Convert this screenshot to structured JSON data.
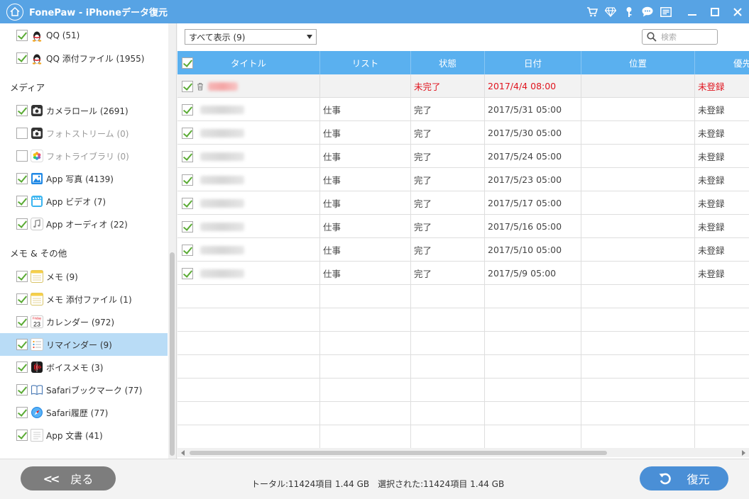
{
  "app": {
    "title": "FonePaw - iPhoneデータ復元"
  },
  "colors": {
    "titlebar": "#57a3e4",
    "header": "#5ab0ef",
    "selected": "#b9dcf6",
    "red": "#e0141e",
    "check": "#5bab35"
  },
  "title_icons": [
    "cart-icon",
    "diamond-icon",
    "key-icon",
    "chat-icon",
    "menu-icon",
    "minimize-icon",
    "maximize-icon",
    "close-icon"
  ],
  "sidebar": {
    "items": [
      {
        "type": "item",
        "label": "QQ (51)",
        "icon": "qq-icon",
        "checked": true
      },
      {
        "type": "item",
        "label": "QQ 添付ファイル (1955)",
        "icon": "qq-icon",
        "checked": true
      },
      {
        "type": "category",
        "label": "メディア"
      },
      {
        "type": "item",
        "label": "カメラロール (2691)",
        "icon": "camera-icon",
        "checked": true
      },
      {
        "type": "item",
        "label": "フォトストリーム (0)",
        "icon": "camera-icon",
        "checked": false,
        "disabled": true
      },
      {
        "type": "item",
        "label": "フォトライブラリ (0)",
        "icon": "photos-icon",
        "checked": false,
        "disabled": true
      },
      {
        "type": "item",
        "label": "App 写真 (4139)",
        "icon": "image-icon",
        "checked": true
      },
      {
        "type": "item",
        "label": "App ビデオ (7)",
        "icon": "clapper-icon",
        "checked": true
      },
      {
        "type": "item",
        "label": "App オーディオ (22)",
        "icon": "music-icon",
        "checked": true
      },
      {
        "type": "category",
        "label": "メモ & その他"
      },
      {
        "type": "item",
        "label": "メモ (9)",
        "icon": "notes-icon",
        "checked": true
      },
      {
        "type": "item",
        "label": "メモ 添付ファイル (1)",
        "icon": "notes-icon",
        "checked": true
      },
      {
        "type": "item",
        "label": "カレンダー (972)",
        "icon": "calendar-icon",
        "checked": true,
        "cal_day": "Friday",
        "cal_num": "23"
      },
      {
        "type": "item",
        "label": "リマインダー (9)",
        "icon": "reminders-icon",
        "checked": true,
        "selected": true
      },
      {
        "type": "item",
        "label": "ボイスメモ (3)",
        "icon": "voice-memo-icon",
        "checked": true
      },
      {
        "type": "item",
        "label": "Safariブックマーク (77)",
        "icon": "bookmark-icon",
        "checked": true
      },
      {
        "type": "item",
        "label": "Safari履歴 (77)",
        "icon": "safari-icon",
        "checked": true
      },
      {
        "type": "item",
        "label": "App 文書 (41)",
        "icon": "document-icon",
        "checked": true
      }
    ]
  },
  "toolbar": {
    "filter": "すべて表示 (9)",
    "search_placeholder": "検索"
  },
  "table": {
    "columns": [
      "タイトル",
      "リスト",
      "状態",
      "日付",
      "位置",
      "優先"
    ],
    "rows": [
      {
        "list": "",
        "status": "未完了",
        "date": "2017/4/4 08:00",
        "location": "",
        "priority": "未登録",
        "red": true,
        "deleted": true
      },
      {
        "list": "仕事",
        "status": "完了",
        "date": "2017/5/31 05:00",
        "location": "",
        "priority": "未登録"
      },
      {
        "list": "仕事",
        "status": "完了",
        "date": "2017/5/30 05:00",
        "location": "",
        "priority": "未登録"
      },
      {
        "list": "仕事",
        "status": "完了",
        "date": "2017/5/24 05:00",
        "location": "",
        "priority": "未登録"
      },
      {
        "list": "仕事",
        "status": "完了",
        "date": "2017/5/23 05:00",
        "location": "",
        "priority": "未登録"
      },
      {
        "list": "仕事",
        "status": "完了",
        "date": "2017/5/17 05:00",
        "location": "",
        "priority": "未登録"
      },
      {
        "list": "仕事",
        "status": "完了",
        "date": "2017/5/16 05:00",
        "location": "",
        "priority": "未登録"
      },
      {
        "list": "仕事",
        "status": "完了",
        "date": "2017/5/10 05:00",
        "location": "",
        "priority": "未登録"
      },
      {
        "list": "仕事",
        "status": "完了",
        "date": "2017/5/9 05:00",
        "location": "",
        "priority": "未登録"
      }
    ]
  },
  "bottom": {
    "back": "戻る",
    "restore": "復元",
    "status": "トータル:11424項目 1.44 GB　選択された:11424項目 1.44 GB"
  }
}
